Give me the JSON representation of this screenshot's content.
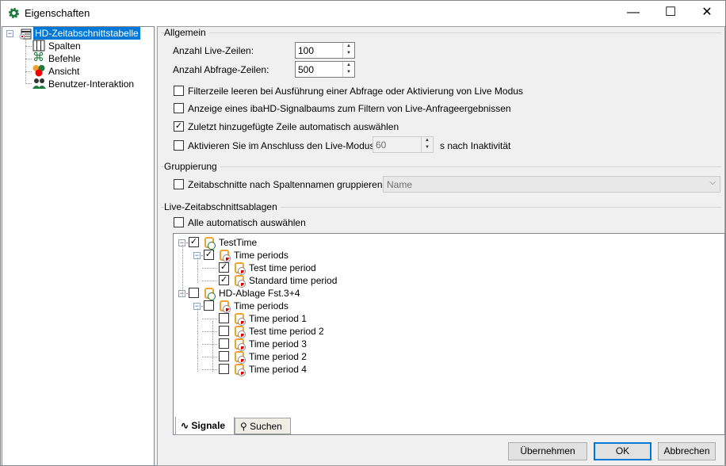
{
  "window": {
    "title": "Eigenschaften",
    "minimize": "—",
    "maximize": "☐",
    "close": "✕"
  },
  "nav": {
    "root": "HD-Zeitabschnittstabelle",
    "items": [
      {
        "label": "Spalten"
      },
      {
        "label": "Befehle"
      },
      {
        "label": "Ansicht"
      },
      {
        "label": "Benutzer-Interaktion"
      }
    ]
  },
  "general": {
    "header": "Allgemein",
    "live_rows_label": "Anzahl Live-Zeilen:",
    "live_rows": "100",
    "query_rows_label": "Anzahl Abfrage-Zeilen:",
    "query_rows": "500",
    "options": [
      {
        "label": "Filterzeile leeren bei Ausführung einer Abfrage oder Aktivierung von Live Modus",
        "checked": false
      },
      {
        "label": "Anzeige eines ibaHD-Signalbaums zum Filtern von Live-Anfrageergebnissen",
        "checked": false
      },
      {
        "label": "Zuletzt hinzugefügte Zeile automatisch auswählen",
        "checked": true
      },
      {
        "label": "Aktivieren Sie im Anschluss den Live-Modus:",
        "checked": false
      }
    ],
    "inactivity_value": "60",
    "inactivity_suffix": "s nach Inaktivität"
  },
  "grouping": {
    "header": "Gruppierung",
    "label": "Zeitabschnitte nach Spaltennamen gruppieren:",
    "checked": false,
    "selected": "Name"
  },
  "stores": {
    "header": "Live-Zeitabschnittsablagen",
    "select_all": "Alle automatisch auswählen",
    "select_all_checked": false,
    "tree": [
      {
        "label": "TestTime",
        "level": 0,
        "checked": true,
        "type": "store"
      },
      {
        "label": "Time periods",
        "level": 1,
        "checked": true,
        "type": "folder"
      },
      {
        "label": "Test time period",
        "level": 2,
        "checked": true,
        "type": "period"
      },
      {
        "label": "Standard time period",
        "level": 2,
        "checked": true,
        "type": "period"
      },
      {
        "label": "HD-Ablage Fst.3+4",
        "level": 0,
        "checked": false,
        "type": "store"
      },
      {
        "label": "Time periods",
        "level": 1,
        "checked": false,
        "type": "folder"
      },
      {
        "label": "Time period 1",
        "level": 2,
        "checked": false,
        "type": "period"
      },
      {
        "label": "Test time period 2",
        "level": 2,
        "checked": false,
        "type": "period"
      },
      {
        "label": "Time period 3",
        "level": 2,
        "checked": false,
        "type": "period"
      },
      {
        "label": "Time period 2",
        "level": 2,
        "checked": false,
        "type": "period"
      },
      {
        "label": "Time period 4",
        "level": 2,
        "checked": false,
        "type": "period"
      }
    ],
    "tabs": [
      {
        "label": "Signale",
        "active": true
      },
      {
        "label": "Suchen",
        "active": false
      }
    ]
  },
  "buttons": {
    "apply": "Übernehmen",
    "ok": "OK",
    "cancel": "Abbrechen"
  },
  "colors": {
    "accent": "#0078d7",
    "gear": "#1e7a3c"
  }
}
